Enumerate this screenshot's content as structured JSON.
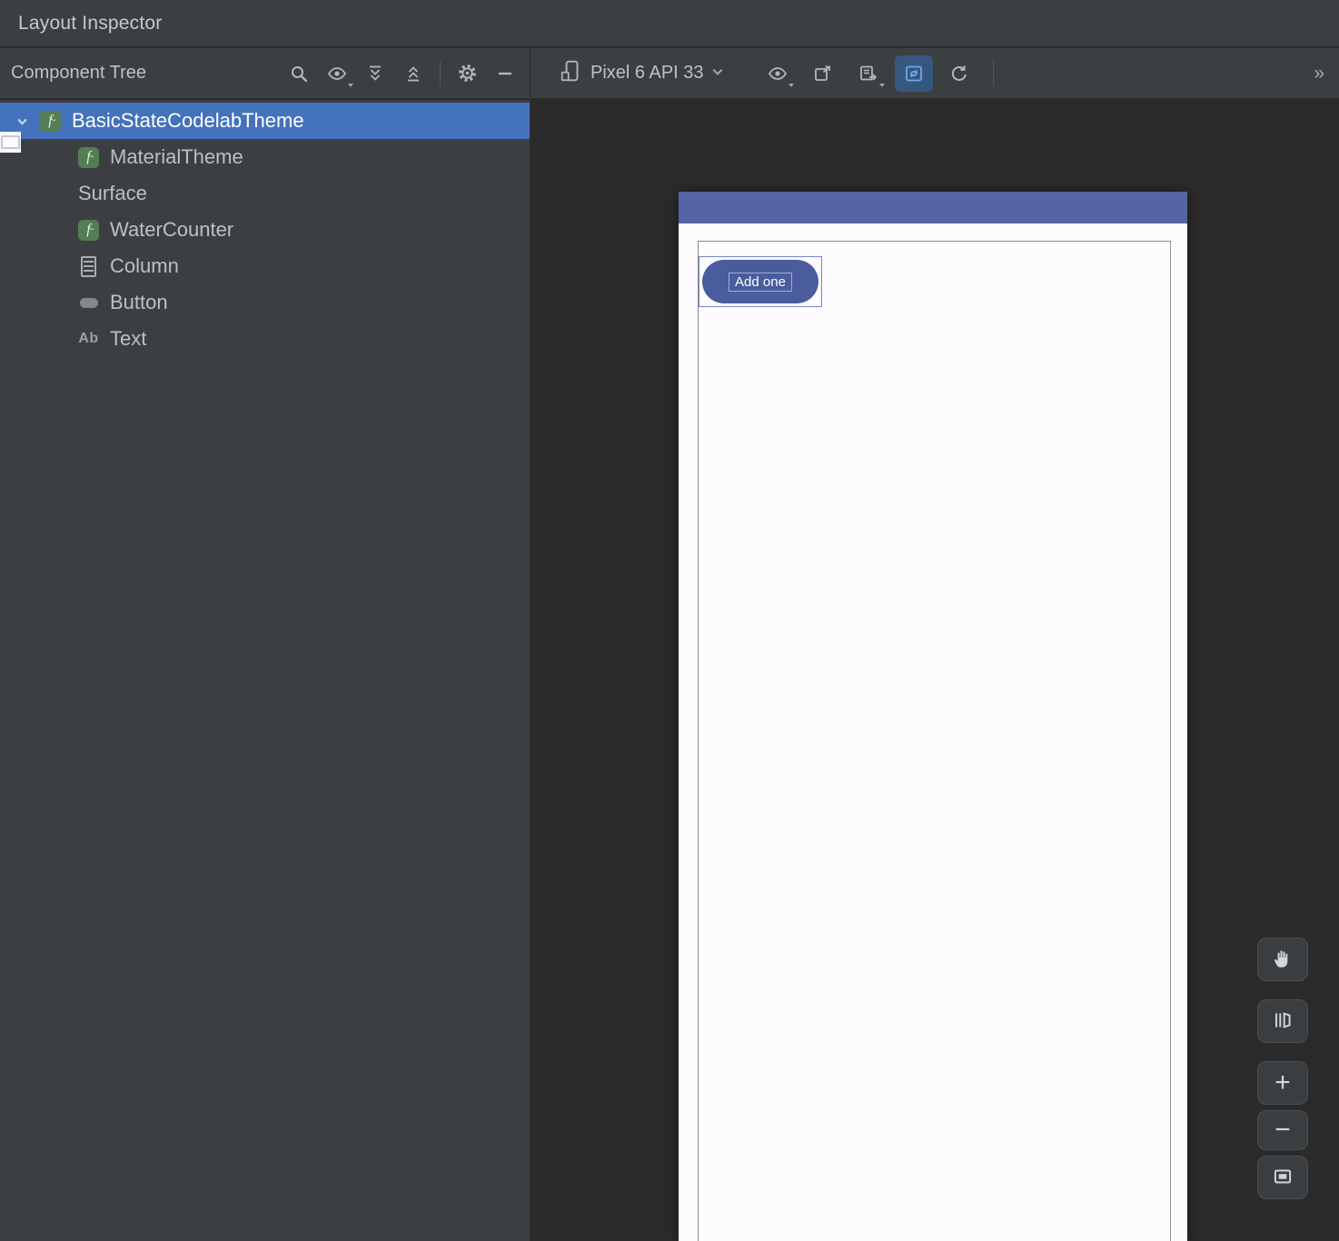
{
  "window": {
    "title": "Layout Inspector"
  },
  "toolbar": {
    "panel_title": "Component Tree",
    "left_icons": [
      "search-icon",
      "visibility-options-icon",
      "expand-all-icon",
      "collapse-all-icon",
      "settings-gear-icon",
      "hide-panel-icon"
    ],
    "device": {
      "label": "Pixel 6 API 33",
      "icon": "device-phone-icon",
      "chevron": "chevron-down-icon"
    },
    "right_icons": [
      "visibility-options-icon",
      "snapshot-icon",
      "export-snapshot-icon",
      "live-updates-toggle-icon",
      "refresh-icon"
    ],
    "live_updates_active": true,
    "overflow_label": "»"
  },
  "tree": {
    "items": [
      {
        "label": "BasicStateCodelabTheme",
        "icon": "composable-icon",
        "indent": 0,
        "selected": true,
        "expanded": true
      },
      {
        "label": "MaterialTheme",
        "icon": "composable-icon",
        "indent": 1,
        "selected": false
      },
      {
        "label": "Surface",
        "icon": "surface-icon",
        "indent": 1,
        "selected": false
      },
      {
        "label": "WaterCounter",
        "icon": "composable-icon",
        "indent": 1,
        "selected": false
      },
      {
        "label": "Column",
        "icon": "column-icon",
        "indent": 1,
        "selected": false
      },
      {
        "label": "Button",
        "icon": "button-icon",
        "indent": 1,
        "selected": false
      },
      {
        "label": "Text",
        "icon": "text-icon",
        "indent": 1,
        "selected": false,
        "icon_text": "Ab"
      }
    ]
  },
  "icons": {
    "composable_glyph": "f",
    "text_glyph": "Ab"
  },
  "canvas": {
    "device_screen": {
      "button_label": "Add one",
      "appbar_color": "#5565a4",
      "button_color": "#4a5c9d",
      "surface_color": "#fdfbfe"
    },
    "controls": {
      "pan": "pan-hand-icon",
      "mode_3d": "3d-mode-icon",
      "zoom_in_label": "+",
      "zoom_out_label": "−",
      "zoom_to_fit": "zoom-to-fit-icon"
    }
  },
  "colors": {
    "panel_bg": "#3c3f41",
    "canvas_bg": "#2b2b2b",
    "selection_bg": "#4472bd",
    "text": "#bdc0c3",
    "live_toggle_bg": "#365880"
  }
}
